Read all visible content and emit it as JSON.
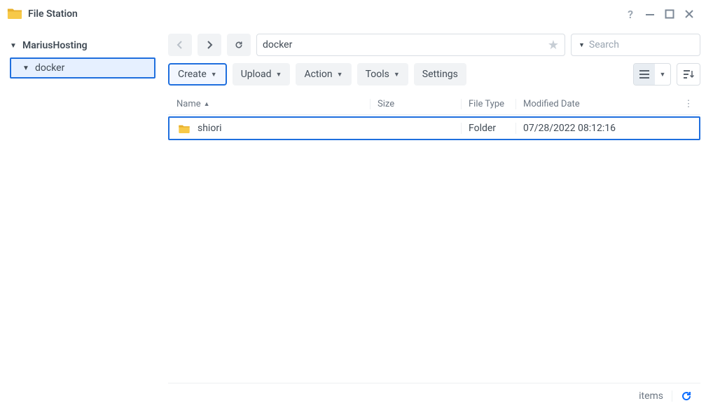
{
  "window": {
    "title": "File Station"
  },
  "sidebar": {
    "root_label": "MariusHosting",
    "items": [
      {
        "label": "docker",
        "selected": true
      }
    ]
  },
  "pathbar": {
    "path_value": "docker"
  },
  "search": {
    "placeholder": "Search"
  },
  "toolbar": {
    "create": "Create",
    "upload": "Upload",
    "action": "Action",
    "tools": "Tools",
    "settings": "Settings"
  },
  "columns": {
    "name": "Name",
    "size": "Size",
    "type": "File Type",
    "modified": "Modified Date"
  },
  "rows": [
    {
      "name": "shiori",
      "size": "",
      "type": "Folder",
      "modified": "07/28/2022 08:12:16"
    }
  ],
  "statusbar": {
    "items_label": "items"
  }
}
